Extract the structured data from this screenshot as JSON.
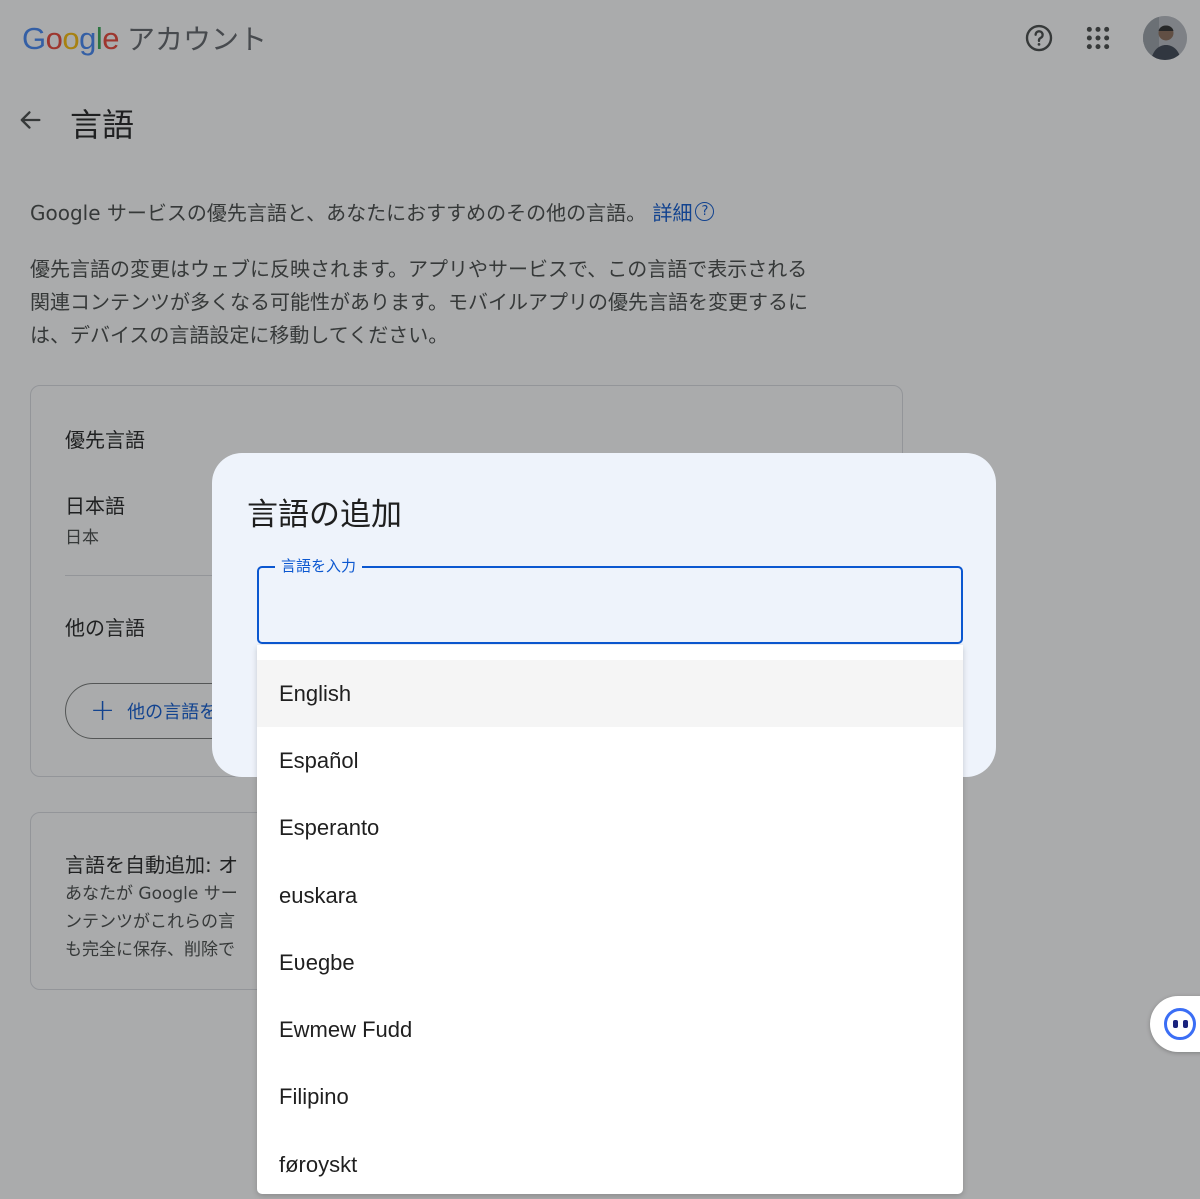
{
  "header": {
    "logo_letters": [
      {
        "char": "G",
        "color": "#4285F4"
      },
      {
        "char": "o",
        "color": "#EA4335"
      },
      {
        "char": "o",
        "color": "#FBBC05"
      },
      {
        "char": "g",
        "color": "#4285F4"
      },
      {
        "char": "l",
        "color": "#34A853"
      },
      {
        "char": "e",
        "color": "#EA4335"
      }
    ],
    "product": "アカウント",
    "icons": [
      "help-icon",
      "apps-grid-icon",
      "avatar"
    ]
  },
  "page": {
    "title": "言語",
    "intro": "Google サービスの優先言語と、あなたにおすすめのその他の言語。",
    "intro_link": "詳細",
    "description": "優先言語の変更はウェブに反映されます。アプリやサービスで、この言語で表示される関連コンテンツが多くなる可能性があります。モバイルアプリの優先言語を変更するには、デバイスの言語設定に移動してください。"
  },
  "preferred_card": {
    "title": "優先言語",
    "language": "日本語",
    "region": "日本",
    "other_title": "他の言語",
    "add_button": "他の言語を"
  },
  "auto_card": {
    "title": "言語を自動追加: オ",
    "text": "あなたが Google サー\nンテンツがこれらの言\nも完全に保存、削除で"
  },
  "dialog": {
    "title": "言語の追加",
    "input_label": "言語を入力",
    "input_value": "",
    "options": [
      "English",
      "Español",
      "Esperanto",
      "euskara",
      "Eʋegbe",
      "Ewmew Fudd",
      "Filipino",
      "føroyskt"
    ],
    "active_index": 0
  },
  "colors": {
    "accent": "#0b57d0",
    "dialog_bg": "#eef3fb",
    "scrim": "rgba(32,33,36,0.38)"
  }
}
